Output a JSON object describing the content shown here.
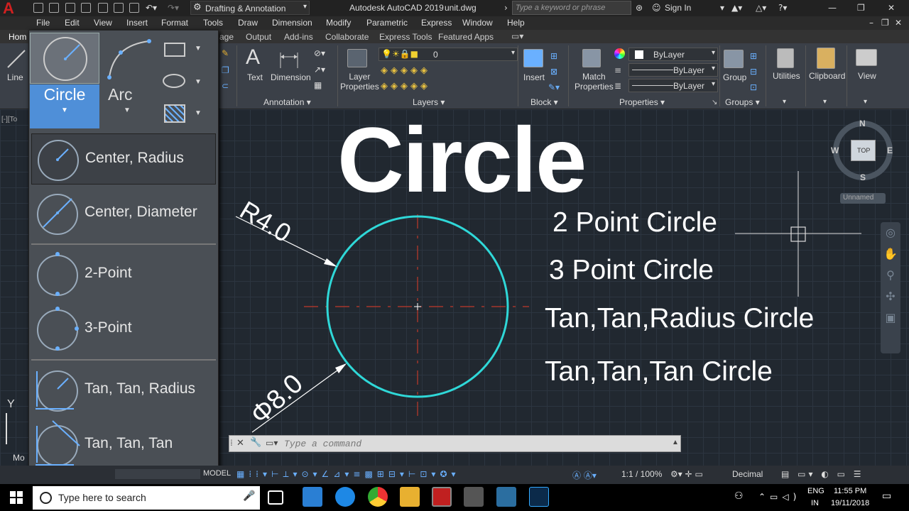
{
  "titlebar": {
    "workspace": "Drafting & Annotation",
    "app_title": "Autodesk AutoCAD 2019",
    "file_name": "unit.dwg",
    "search_placeholder": "Type a keyword or phrase",
    "sign_in": "Sign In"
  },
  "menubar": {
    "items": [
      "File",
      "Edit",
      "View",
      "Insert",
      "Format",
      "Tools",
      "Draw",
      "Dimension",
      "Modify",
      "Parametric",
      "Express",
      "Window",
      "Help"
    ]
  },
  "ribbon": {
    "tab_partial": "Hom",
    "tabs": [
      "age",
      "Output",
      "Add-ins",
      "Collaborate",
      "Express Tools",
      "Featured Apps"
    ],
    "line_label": "Line",
    "text_label": "Text",
    "dimension_label": "Dimension",
    "annotation_panel": "Annotation",
    "layer_properties": "Layer\nProperties",
    "layers_panel": "Layers",
    "layer_value": "0",
    "insert_label": "Insert",
    "block_panel": "Block",
    "match_properties": "Match\nProperties",
    "properties_panel": "Properties",
    "bylayer_1": "ByLayer",
    "bylayer_2": "ByLayer",
    "bylayer_3": "ByLayer",
    "group_label": "Group",
    "groups_panel": "Groups",
    "utilities_label": "Utilities",
    "clipboard_label": "Clipboard",
    "view_label": "View"
  },
  "circle_menu": {
    "circle_label": "Circle",
    "arc_label": "Arc",
    "items": [
      "Center, Radius",
      "Center, Diameter",
      "2-Point",
      "3-Point",
      "Tan, Tan, Radius",
      "Tan, Tan, Tan"
    ]
  },
  "drawing": {
    "big_title": "Circle",
    "radius_label": "R4.0",
    "diameter_label": "Φ8.0",
    "types": [
      "2 Point Circle",
      "3 Point Circle",
      "Tan,Tan,Radius Circle",
      "Tan,Tan,Tan Circle"
    ],
    "viewcube": {
      "n": "N",
      "s": "S",
      "e": "E",
      "w": "W",
      "top": "TOP"
    },
    "unnamed": "Unnamed",
    "ucs_y": "Y",
    "model_tab": "Mo",
    "vp_label": "[-][To"
  },
  "colors": {
    "circle": "#2fd8d8",
    "centerline": "#c0392b",
    "accent": "#4f8fd8"
  },
  "command": {
    "placeholder": "Type a command"
  },
  "statusbar": {
    "model": "MODEL",
    "scale": "1:1 / 100%",
    "units": "Decimal"
  },
  "taskbar": {
    "search_text": "Type here to search",
    "lang_1": "ENG",
    "lang_2": "IN",
    "time": "11:55 PM",
    "date": "19/11/2018"
  }
}
